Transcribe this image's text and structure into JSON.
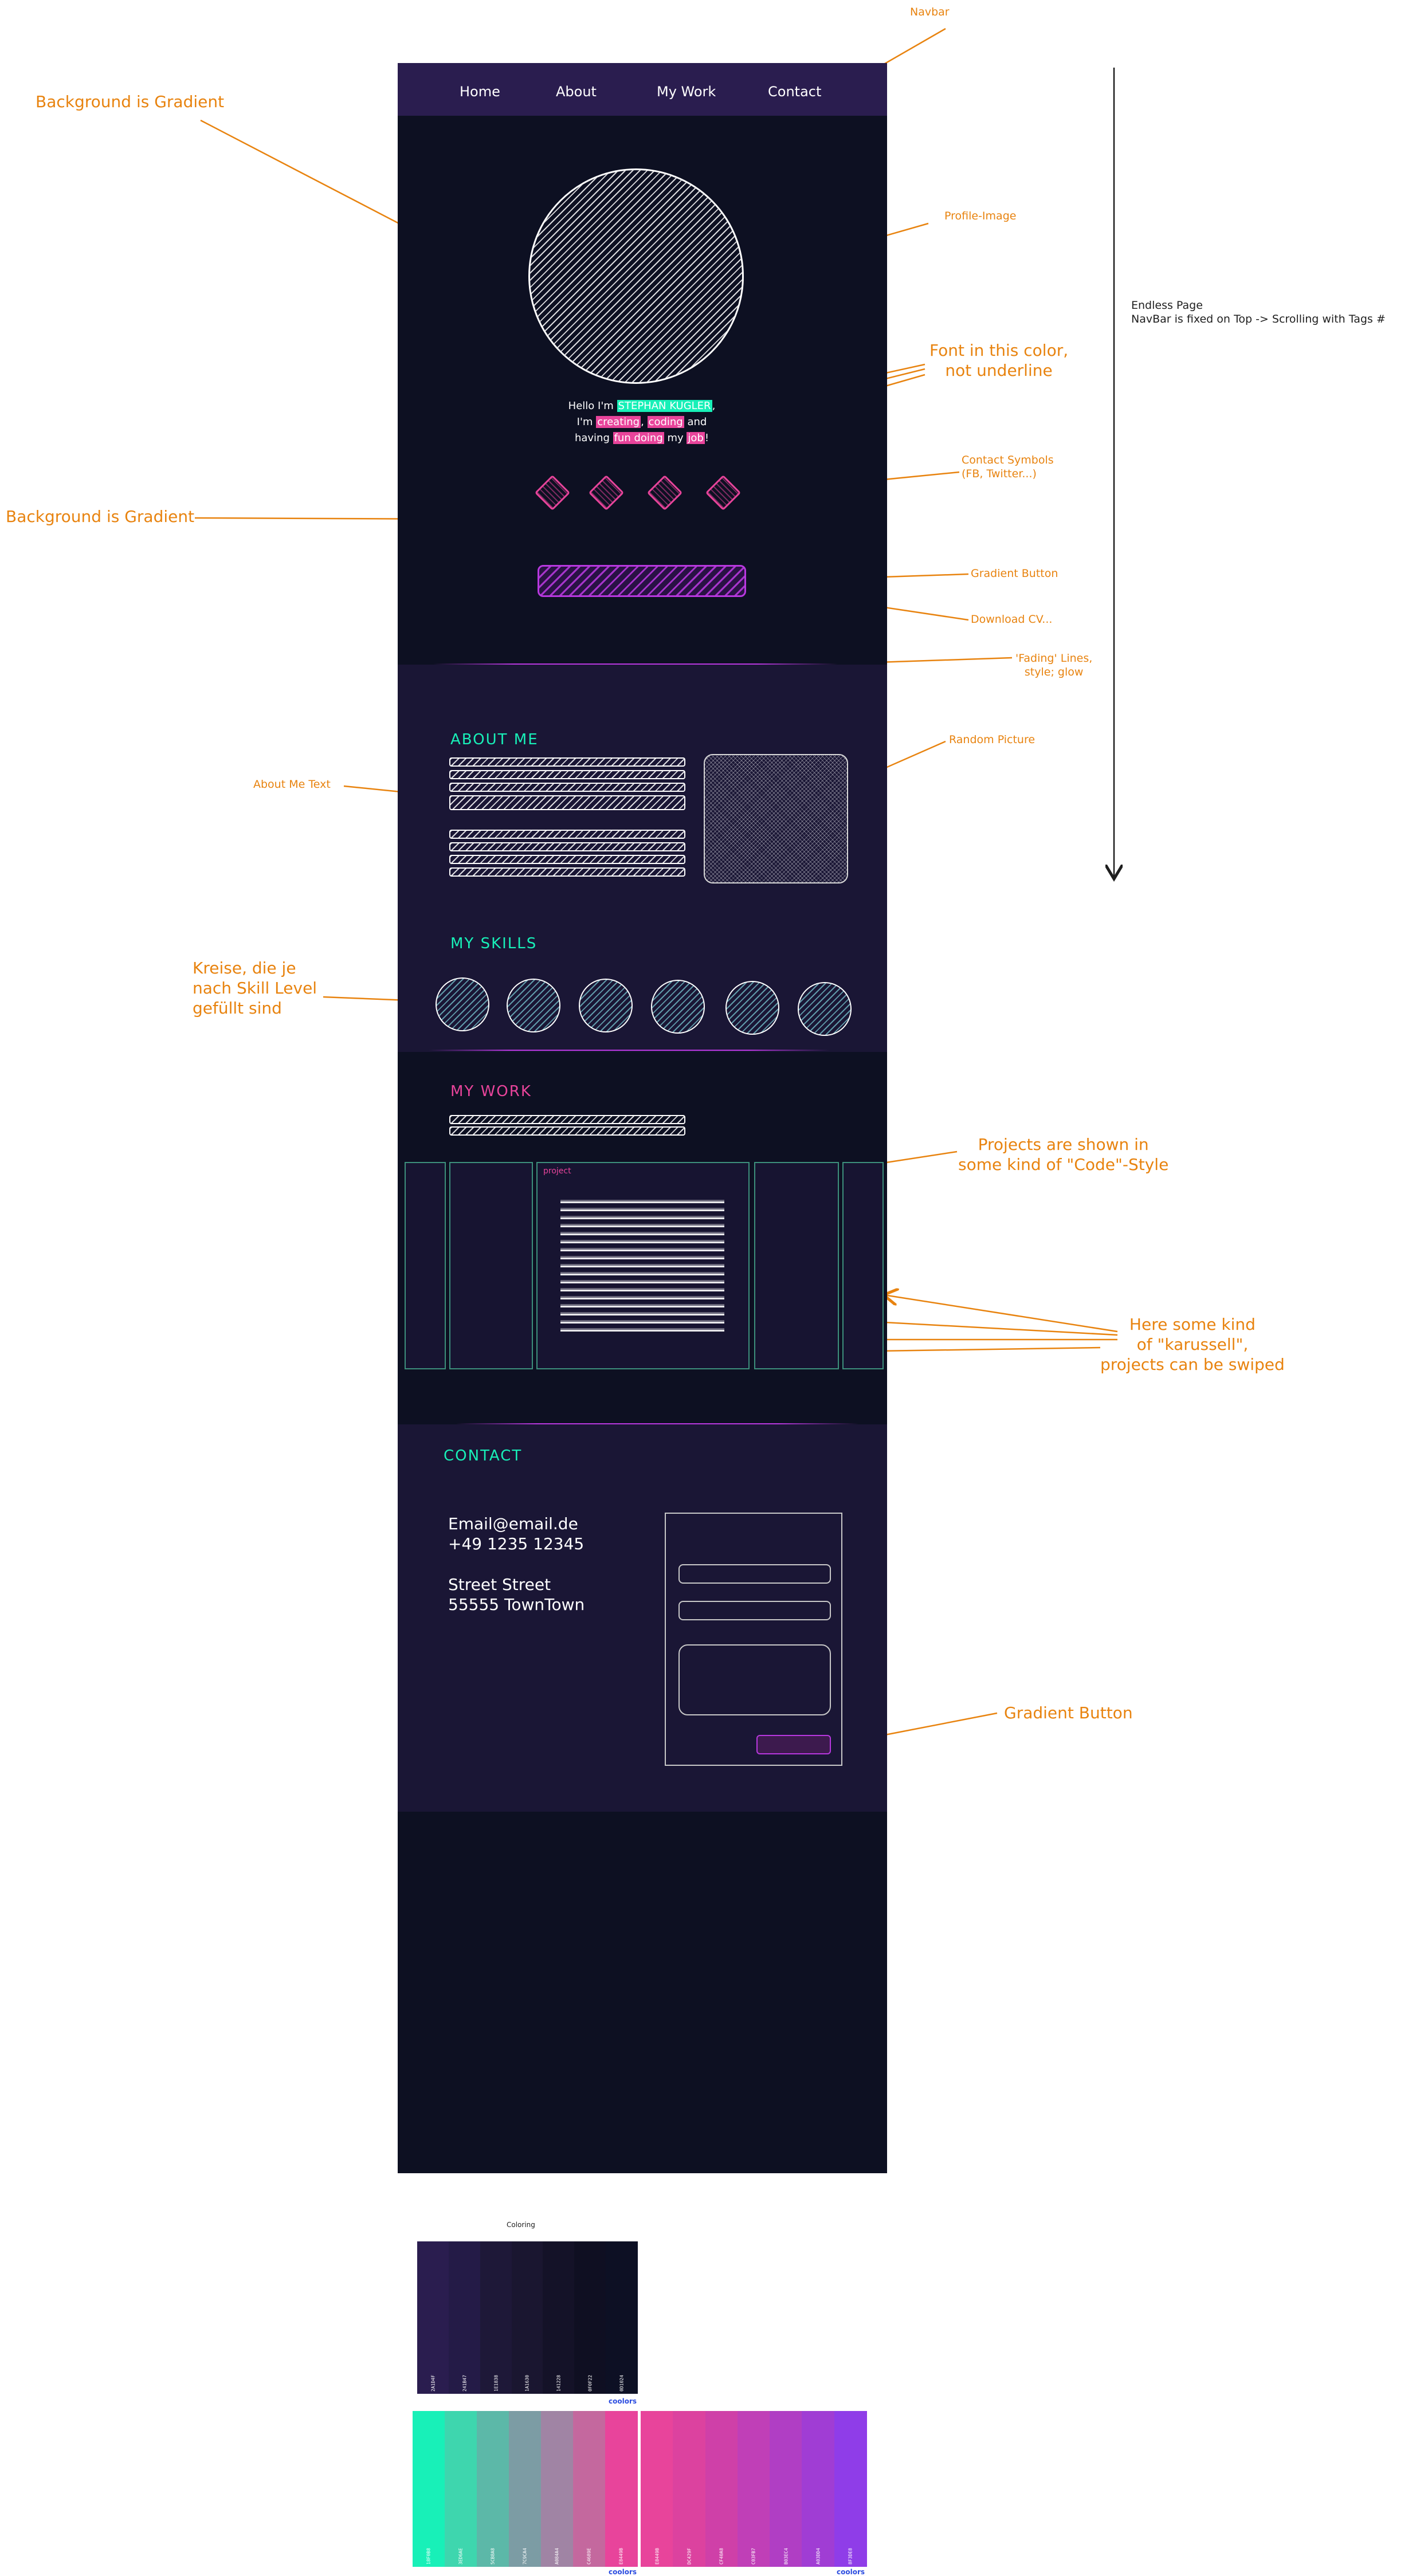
{
  "annotations": {
    "navbar": "Navbar",
    "background_gradient_top": "Background is Gradient",
    "background_gradient_mid": "Background is Gradient",
    "profile_image": "Profile-Image",
    "font_color": "Font in this color,\nnot underline",
    "contact_symbols": "Contact Symbols\n(FB, Twitter...)",
    "gradient_button_top": "Gradient Button",
    "download_cv": "Download CV...",
    "fading_lines": "'Fading' Lines,\nstyle; glow",
    "endless_page": "Endless Page\nNavBar is fixed on Top -> Scrolling with Tags #",
    "random_picture": "Random Picture",
    "about_me_text": "About Me Text",
    "skill_circles": "Kreise, die je\nnach Skill Level\ngefüllt sind",
    "code_style": "Projects are shown in\nsome kind of \"Code\"-Style",
    "karussell": "Here some kind\nof \"karussell\",\nprojects can be swiped",
    "gradient_button_contact": "Gradient Button",
    "coloring": "Coloring"
  },
  "navbar": {
    "items": [
      "Home",
      "About",
      "My Work",
      "Contact"
    ]
  },
  "hero": {
    "line1_prefix": "Hello I'm ",
    "line1_name": "STEPHAN KUGLER",
    "line1_suffix": ",",
    "line2_prefix": "I'm ",
    "line2_word1": "creating",
    "line2_sep": ", ",
    "line2_word2": "coding",
    "line2_suffix": " and",
    "line3_prefix": "having ",
    "line3_word1": "fun doing",
    "line3_mid": " my ",
    "line3_word2": "job",
    "line3_suffix": "!"
  },
  "about": {
    "title": "ABOUT ME"
  },
  "skills": {
    "title": "MY SKILLS",
    "count": 6
  },
  "work": {
    "title": "MY WORK",
    "project_label": "project"
  },
  "contact": {
    "title": "CONTACT",
    "email": "Email@email.de",
    "phone": "+49 1235 12345",
    "street": "Street Street",
    "city": "55555 TownTown"
  },
  "colors": {
    "accent_green": "#18f0b8",
    "accent_pink": "#e8449b",
    "accent_purple": "#8f3de8",
    "navbar_bg": "#2a1d4f",
    "page_bg": "#0d1022",
    "section_bg": "#1a1635",
    "annotation": "#e8830f"
  },
  "palette_dark": [
    {
      "hex": "#2a1d4f",
      "label": "2A1D4F"
    },
    {
      "hex": "#241b47",
      "label": "241B47"
    },
    {
      "hex": "#1e1838",
      "label": "1E1838"
    },
    {
      "hex": "#1a1630",
      "label": "1A1630"
    },
    {
      "hex": "#141228",
      "label": "141228"
    },
    {
      "hex": "#0f0f22",
      "label": "0F0F22"
    },
    {
      "hex": "#0d1024",
      "label": "0D1024"
    }
  ],
  "palette_green_pink": [
    {
      "hex": "#18f0b8",
      "label": "18F0B8"
    },
    {
      "hex": "#3ed6ae",
      "label": "3ED6AE"
    },
    {
      "hex": "#5cb8a8",
      "label": "5CB8A8"
    },
    {
      "hex": "#7c9ca4",
      "label": "7C9CA4"
    },
    {
      "hex": "#a084a4",
      "label": "A084A4"
    },
    {
      "hex": "#c4689e",
      "label": "C4689E"
    },
    {
      "hex": "#e8449b",
      "label": "E8449B"
    }
  ],
  "palette_pink_purple": [
    {
      "hex": "#e8449b",
      "label": "E8449B"
    },
    {
      "hex": "#dc429f",
      "label": "DC429F"
    },
    {
      "hex": "#cf40a8",
      "label": "CF40A8"
    },
    {
      "hex": "#c03fb7",
      "label": "C03FB7"
    },
    {
      "hex": "#b03ec4",
      "label": "B03EC4"
    },
    {
      "hex": "#a03dd4",
      "label": "A03DD4"
    },
    {
      "hex": "#8f3de8",
      "label": "8F3DE8"
    }
  ],
  "coolors_label": "coolors"
}
